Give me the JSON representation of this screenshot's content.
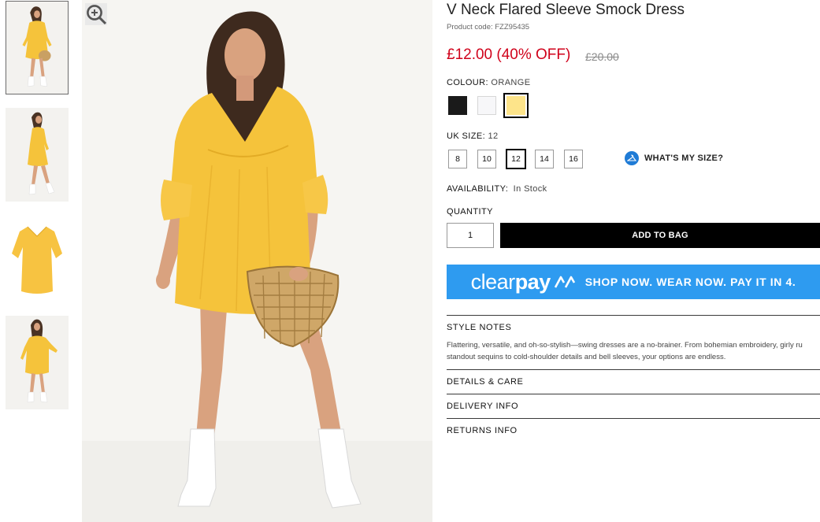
{
  "product": {
    "title": "V Neck Flared Sleeve Smock Dress",
    "code_label": "Product code: FZZ95435",
    "price_text": "£12.00 (40% OFF)",
    "was_price": "£20.00"
  },
  "colour": {
    "label": "COLOUR:",
    "selected": "ORANGE",
    "swatches": [
      {
        "name": "black",
        "hex": "#1a1a1a"
      },
      {
        "name": "white",
        "hex": "#f7f7f9"
      },
      {
        "name": "orange",
        "hex": "#fde48a"
      }
    ]
  },
  "size": {
    "label": "UK SIZE:",
    "selected": "12",
    "options": [
      "8",
      "10",
      "12",
      "14",
      "16"
    ],
    "help_label": "WHAT'S MY SIZE?",
    "help_icon": "hanger-icon"
  },
  "availability": {
    "label": "AVAILABILITY:",
    "value": "In Stock"
  },
  "quantity": {
    "label": "QUANTITY",
    "value": "1"
  },
  "add_to_bag": "ADD TO BAG",
  "clearpay": {
    "logo_light": "clear",
    "logo_bold": "pay",
    "tagline": "SHOP NOW. WEAR NOW. PAY IT IN 4.",
    "background": "#2e9bf0"
  },
  "sections": {
    "style_notes": {
      "title": "STYLE NOTES",
      "line1": "Flattering, versatile, and oh-so-stylish—swing dresses are a no-brainer. From bohemian embroidery, girly ru",
      "line2": "standout sequins to cold-shoulder details and bell sleeves, your options are endless."
    },
    "details_care": "DETAILS & CARE",
    "delivery_info": "DELIVERY INFO",
    "returns_info": "RETURNS INFO"
  },
  "gallery": {
    "thumbnails": [
      "front",
      "side",
      "flat",
      "back"
    ],
    "zoom_icon": "zoom-in-icon"
  },
  "colors": {
    "price_red": "#d0021b",
    "dress_yellow": "#f5c33b",
    "clearpay_blue": "#2e9bf0"
  }
}
